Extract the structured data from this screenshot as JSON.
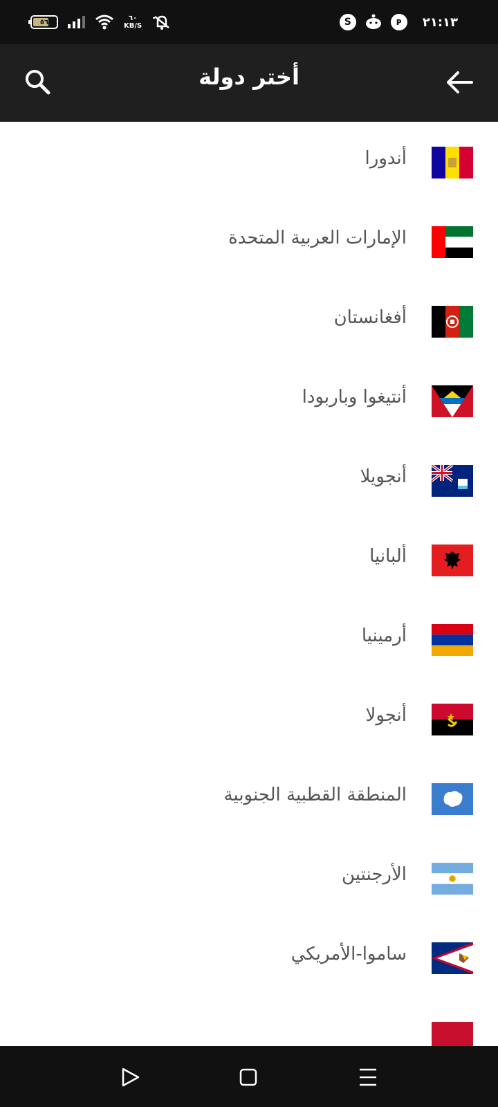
{
  "status_bar": {
    "battery_level": "٥٦",
    "network_speed_value": "٦٠",
    "network_speed_unit": "KB/S",
    "time": "٢١:١٣"
  },
  "app_bar": {
    "title": "أختر دولة",
    "search_icon": "search-icon",
    "back_icon": "arrow-back-icon"
  },
  "countries": [
    {
      "name": "أندورا",
      "flag": "andorra"
    },
    {
      "name": "الإمارات العربية المتحدة",
      "flag": "uae"
    },
    {
      "name": "أفغانستان",
      "flag": "afghanistan"
    },
    {
      "name": "أنتيغوا وباربودا",
      "flag": "antigua"
    },
    {
      "name": "أنجويلا",
      "flag": "anguilla"
    },
    {
      "name": "ألبانيا",
      "flag": "albania"
    },
    {
      "name": "أرمينيا",
      "flag": "armenia"
    },
    {
      "name": "أنجولا",
      "flag": "angola"
    },
    {
      "name": "المنطقة القطبية الجنوبية",
      "flag": "antarctica"
    },
    {
      "name": "الأرجنتين",
      "flag": "argentina"
    },
    {
      "name": "ساموا-الأمريكي",
      "flag": "american-samoa"
    }
  ],
  "nav_bar": {
    "back": "triangle-back-icon",
    "home": "square-home-icon",
    "menu": "menu-icon"
  }
}
